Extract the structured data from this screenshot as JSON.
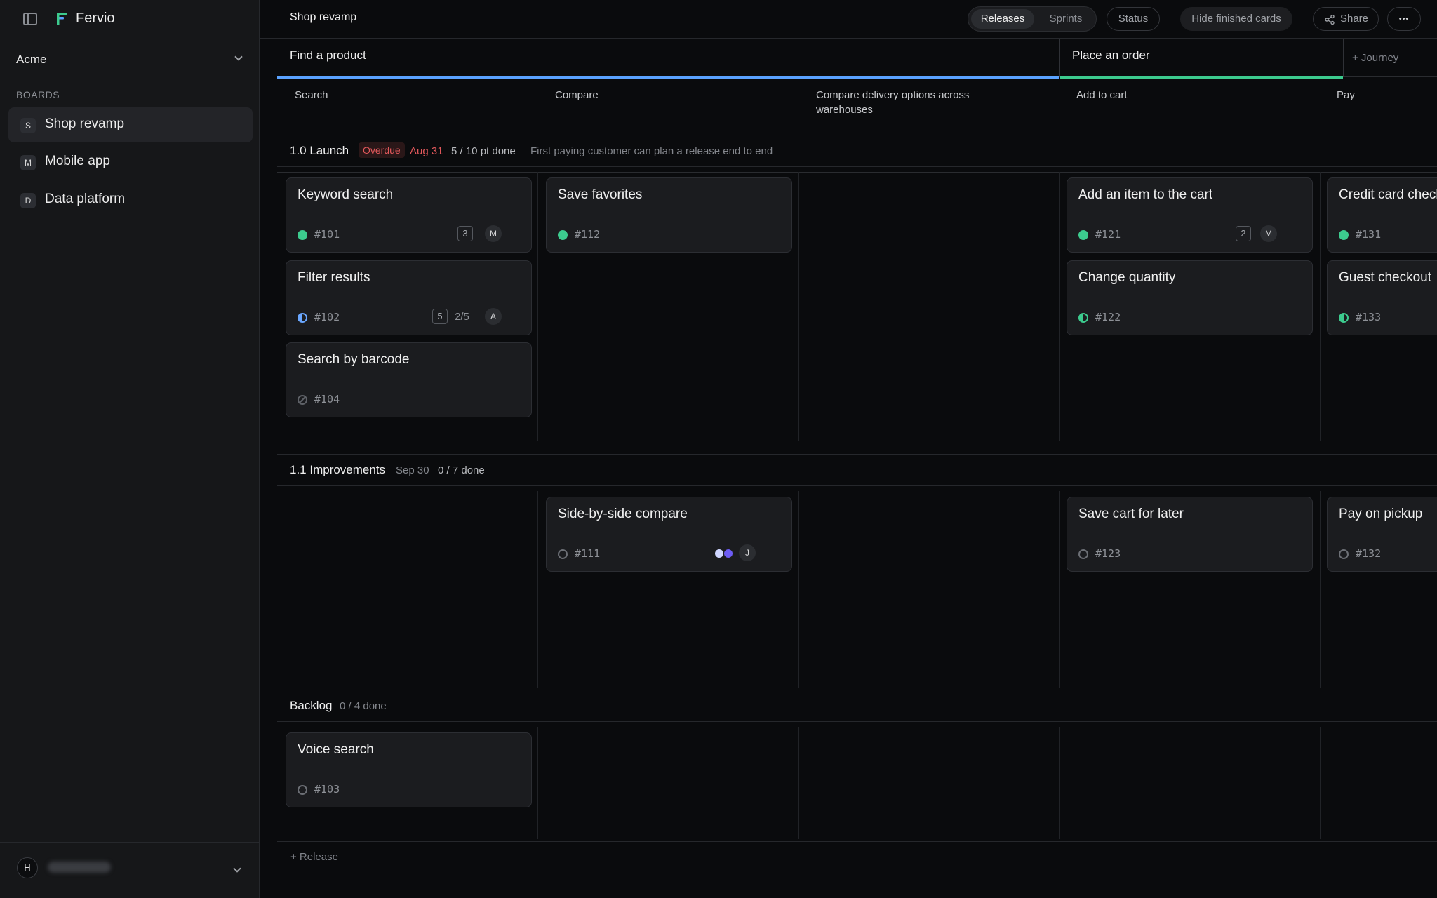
{
  "app": {
    "brand": "Fervio",
    "workspace": "Acme"
  },
  "sidebar": {
    "section_label": "BOARDS",
    "boards": [
      {
        "badge": "S",
        "label": "Shop revamp",
        "active": true
      },
      {
        "badge": "M",
        "label": "Mobile app",
        "active": false
      },
      {
        "badge": "D",
        "label": "Data platform",
        "active": false
      }
    ],
    "user_avatar": "H"
  },
  "topbar": {
    "title": "Shop revamp",
    "view_tabs": [
      {
        "label": "Releases",
        "active": true
      },
      {
        "label": "Sprints",
        "active": false
      }
    ],
    "status_label": "Status",
    "hide_finished_label": "Hide finished cards",
    "share_label": "Share",
    "more_label": "•••"
  },
  "journeys": [
    {
      "label": "Find a product",
      "color": "#5aa2ff"
    },
    {
      "label": "Place an order",
      "color": "#3ccb8e"
    }
  ],
  "add_journey_label": "+ Journey",
  "steps": [
    "Search",
    "Compare",
    "Compare delivery options across warehouses",
    "Add to cart",
    "Pay"
  ],
  "releases": [
    {
      "title": "1.0 Launch",
      "overdue_label": "Overdue",
      "date": "Aug 31",
      "progress": "5 / 10 pt done",
      "goal": "First paying customer can plan a release end to end",
      "cards": [
        {
          "title": "Keyword search",
          "id": "#101",
          "status": "done",
          "points": "3",
          "assignee": "M"
        },
        {
          "title": "Filter results",
          "id": "#102",
          "status": "in-progress-blue",
          "points": "5",
          "subtasks": "2/5",
          "assignee": "A"
        },
        {
          "title": "Search by barcode",
          "id": "#104",
          "status": "blocked"
        },
        {
          "title": "Save favorites",
          "id": "#112",
          "status": "done"
        },
        {
          "title": "Add an item to the cart",
          "id": "#121",
          "status": "done",
          "points": "2",
          "assignee": "M"
        },
        {
          "title": "Change quantity",
          "id": "#122",
          "status": "in-progress-green"
        },
        {
          "title": "Credit card checkout",
          "id": "#131",
          "status": "done"
        },
        {
          "title": "Guest checkout",
          "id": "#133",
          "status": "in-progress-green"
        }
      ]
    },
    {
      "title": "1.1 Improvements",
      "date": "Sep 30",
      "progress": "0 / 7 done",
      "cards": [
        {
          "title": "Side-by-side compare",
          "id": "#111",
          "status": "open",
          "assignee": "J",
          "dot_colors": [
            "#cfd6ff",
            "#6d5cf5"
          ]
        },
        {
          "title": "Save cart for later",
          "id": "#123",
          "status": "open"
        },
        {
          "title": "Pay on pickup",
          "id": "#132",
          "status": "open"
        }
      ]
    },
    {
      "title": "Backlog",
      "progress": "0 / 4 done",
      "cards": [
        {
          "title": "Voice search",
          "id": "#103",
          "status": "open"
        }
      ]
    }
  ],
  "add_release_label": "+ Release"
}
